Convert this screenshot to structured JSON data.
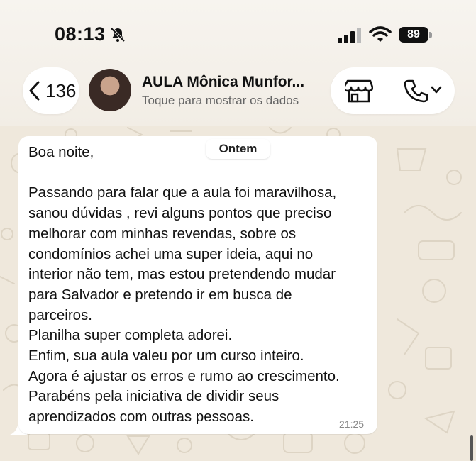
{
  "status_bar": {
    "time": "08:13",
    "battery": "89",
    "icons": [
      "bell-slash-icon",
      "cellular-signal-icon",
      "wifi-icon",
      "battery-icon"
    ]
  },
  "header": {
    "back_count": "136",
    "contact_name": "AULA Mônica Munfor...",
    "contact_subtitle": "Toque para mostrar os dados",
    "icons": [
      "chevron-left-icon",
      "store-icon",
      "phone-icon",
      "chevron-down-icon"
    ]
  },
  "chat": {
    "date_chip": "Ontem",
    "message": {
      "text": "Boa noite,\n\nPassando para falar que a aula foi maravilhosa,\nsanou dúvidas , revi alguns pontos que preciso\nmelhorar com minhas revendas, sobre os\ncondomínios achei uma super ideia, aqui no\ninterior não tem, mas estou pretendendo mudar\npara Salvador e pretendo ir em busca de\nparceiros.\nPlanilha super completa adorei.\nEnfim, sua aula valeu por um curso inteiro.\nAgora é ajustar os erros e rumo ao crescimento.\nParabéns pela iniciativa de dividir seus\naprendizados com outras pessoas.",
      "time": "21:25"
    }
  },
  "colors": {
    "wallpaper": "#efe8dc",
    "bubble": "#ffffff",
    "header": "#f5f1ea"
  }
}
